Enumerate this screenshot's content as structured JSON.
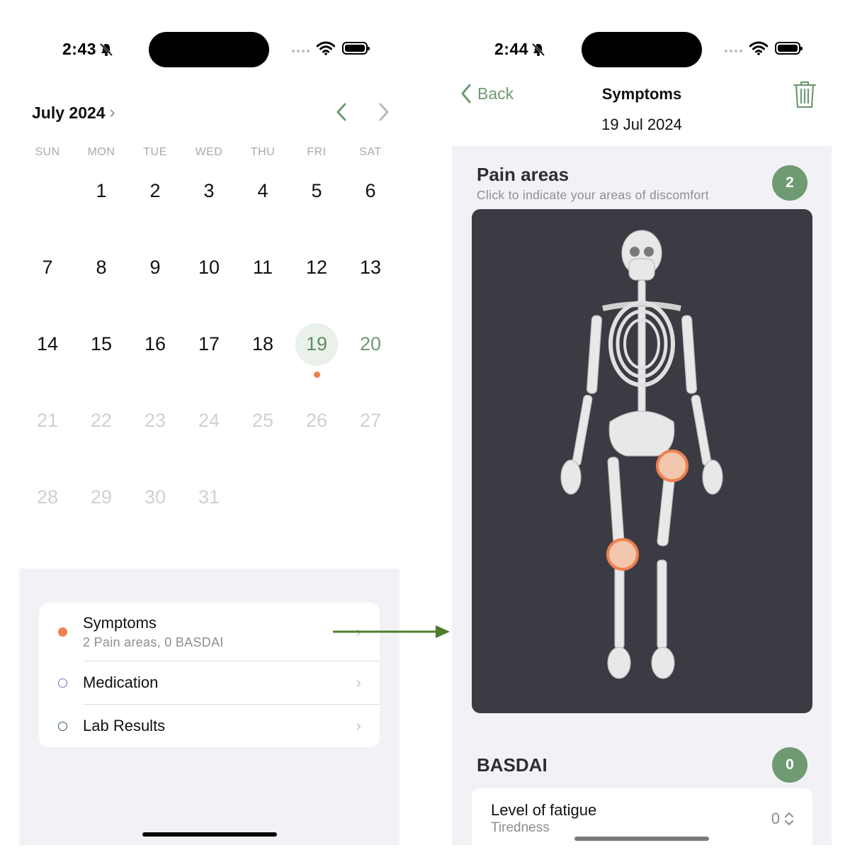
{
  "left": {
    "status": {
      "time": "2:43"
    },
    "calendar": {
      "month_label": "July 2024",
      "weekdays": [
        "SUN",
        "MON",
        "TUE",
        "WED",
        "THU",
        "FRI",
        "SAT"
      ],
      "days": [
        "1",
        "2",
        "3",
        "4",
        "5",
        "6",
        "7",
        "8",
        "9",
        "10",
        "11",
        "12",
        "13",
        "14",
        "15",
        "16",
        "17",
        "18",
        "19",
        "20",
        "21",
        "22",
        "23",
        "24",
        "25",
        "26",
        "27",
        "28",
        "29",
        "30",
        "31"
      ],
      "selected_day": "19",
      "accent_color": "#6f9a72",
      "event_dot_color": "#f07f4f"
    },
    "list": {
      "symptoms": {
        "title": "Symptoms",
        "subtitle": "2 Pain areas, 0 BASDAI",
        "bullet_color": "#f07f4f"
      },
      "medication": {
        "title": "Medication",
        "bullet_color": "#7b6fd0"
      },
      "lab_results": {
        "title": "Lab Results",
        "bullet_color": "#2d5a4f"
      }
    }
  },
  "right": {
    "status": {
      "time": "2:44"
    },
    "nav": {
      "back_label": "Back",
      "title": "Symptoms",
      "date": "19 Jul 2024"
    },
    "pain_areas": {
      "title": "Pain areas",
      "subtitle": "Click to indicate your areas of discomfort",
      "count": "2",
      "marked_areas": [
        "left-hip",
        "right-knee"
      ]
    },
    "basdai": {
      "title": "BASDAI",
      "count": "0",
      "question": {
        "title": "Level of fatigue",
        "subtitle": "Tiredness",
        "value": "0"
      }
    }
  }
}
